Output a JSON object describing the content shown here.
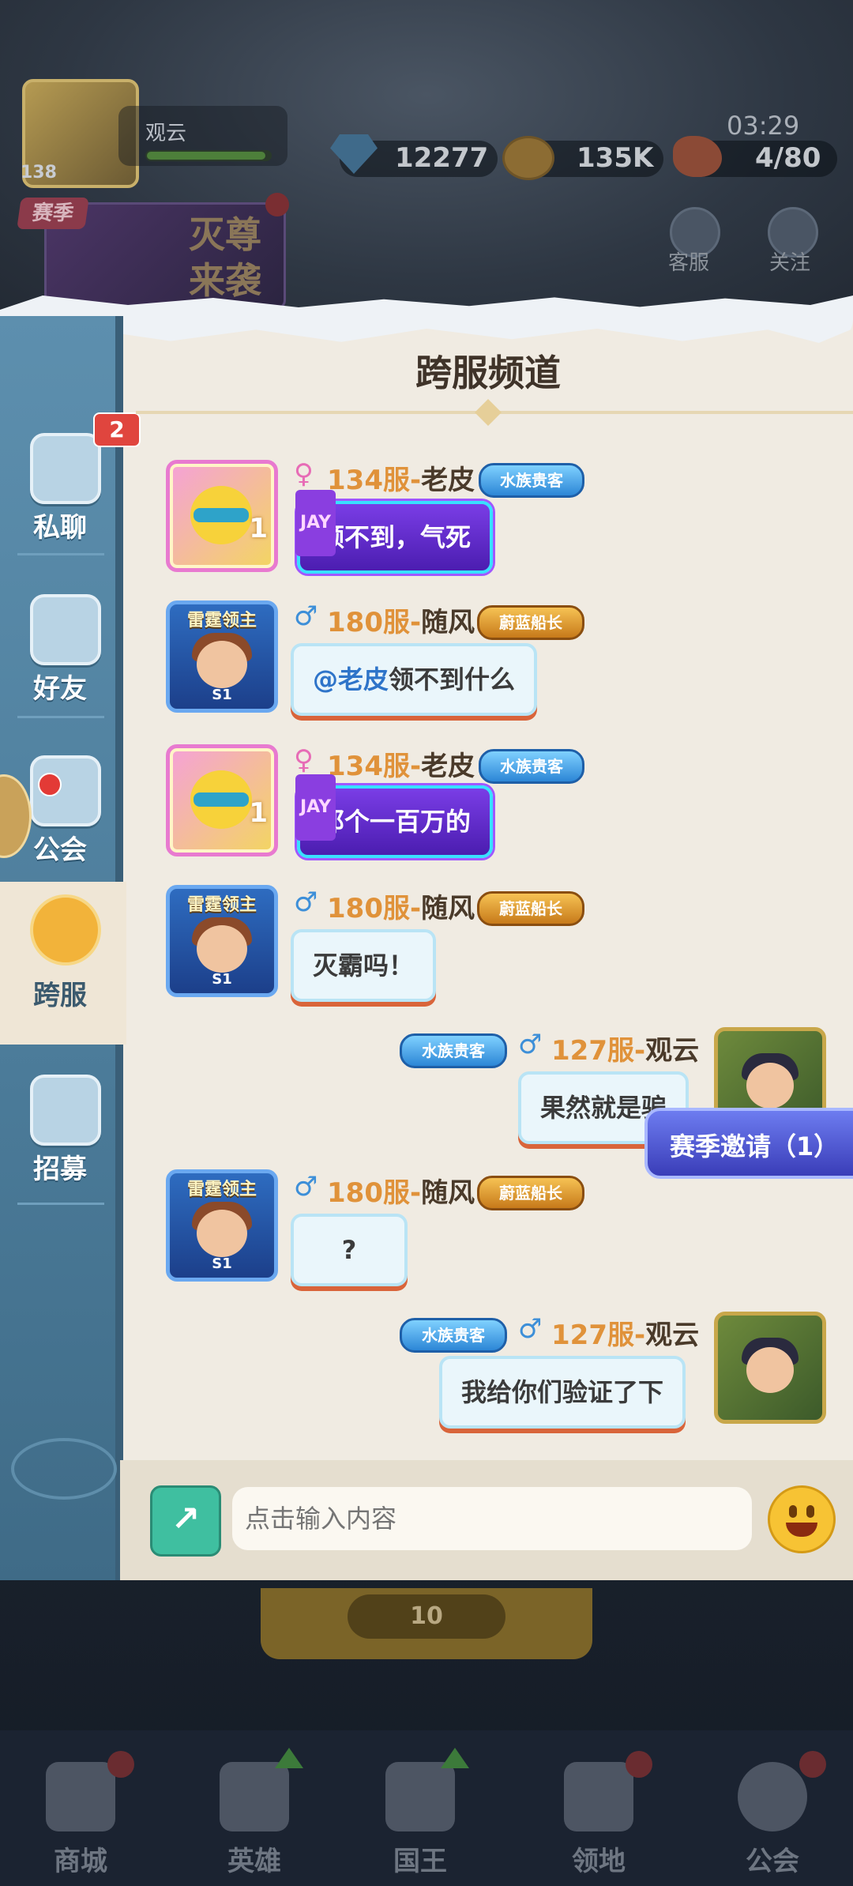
{
  "hud": {
    "level": "138",
    "player_name": "观云",
    "gems": "12277",
    "coins": "135K",
    "timer": "03:29",
    "stamina": "4/80",
    "season_tag": "赛季",
    "season_banner": "灭尊来袭",
    "service_label": "客服",
    "follow_label": "关注"
  },
  "panel": {
    "title": "跨服频道",
    "tabs": [
      {
        "label": "私聊",
        "badge": "2"
      },
      {
        "label": "好友"
      },
      {
        "label": "公会"
      },
      {
        "label": "跨服"
      },
      {
        "label": "招募"
      }
    ]
  },
  "messages": [
    {
      "gender": "♀",
      "server": "134服-",
      "nick": "老皮",
      "title": "水族贵客",
      "text": "领不到，气死",
      "bubble_tag": "JAY",
      "avatar_num": "1"
    },
    {
      "gender": "♂",
      "server": "180服-",
      "nick": "随风",
      "title": "蔚蓝船长",
      "mention": "@老皮",
      "text": "领不到什么",
      "avatar_tag": "雷霆领主",
      "avatar_sub": "S1"
    },
    {
      "gender": "♀",
      "server": "134服-",
      "nick": "老皮",
      "title": "水族贵客",
      "text": "那个一百万的",
      "bubble_tag": "JAY",
      "avatar_num": "1"
    },
    {
      "gender": "♂",
      "server": "180服-",
      "nick": "随风",
      "title": "蔚蓝船长",
      "text": "灭霸吗！",
      "avatar_tag": "雷霆领主",
      "avatar_sub": "S1"
    },
    {
      "gender": "♂",
      "server": "127服-",
      "nick": "观云",
      "title": "水族贵客",
      "text": "果然就是骗"
    },
    {
      "gender": "♂",
      "server": "180服-",
      "nick": "随风",
      "title": "蔚蓝船长",
      "text": "?",
      "avatar_tag": "雷霆领主",
      "avatar_sub": "S1"
    },
    {
      "gender": "♂",
      "server": "127服-",
      "nick": "观云",
      "title": "水族贵客",
      "text": "我给你们验证了下"
    }
  ],
  "invite": "赛季邀请（1）",
  "input": {
    "placeholder": "点击输入内容"
  },
  "bottom": {
    "cost": "10",
    "nav": [
      {
        "label": "商城"
      },
      {
        "label": "英雄"
      },
      {
        "label": "国王"
      },
      {
        "label": "领地"
      },
      {
        "label": "公会"
      }
    ]
  },
  "colors": {
    "sidebar": "#4b7b99",
    "panel_bg": "#f0ebe2",
    "server_text": "#e0923a",
    "male": "#3d8fd8",
    "female": "#e76cb6",
    "purple_bubble": "#5a2bc8",
    "badge_red": "#e0453e"
  }
}
